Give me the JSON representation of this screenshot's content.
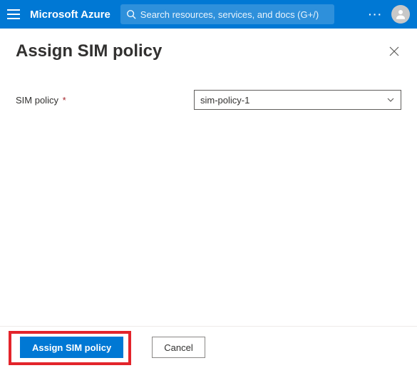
{
  "header": {
    "brand": "Microsoft Azure",
    "search_placeholder": "Search resources, services, and docs (G+/)"
  },
  "panel": {
    "title": "Assign SIM policy",
    "field_label": "SIM policy",
    "field_required_marker": "*",
    "dropdown_value": "sim-policy-1"
  },
  "footer": {
    "primary_label": "Assign SIM policy",
    "secondary_label": "Cancel"
  }
}
